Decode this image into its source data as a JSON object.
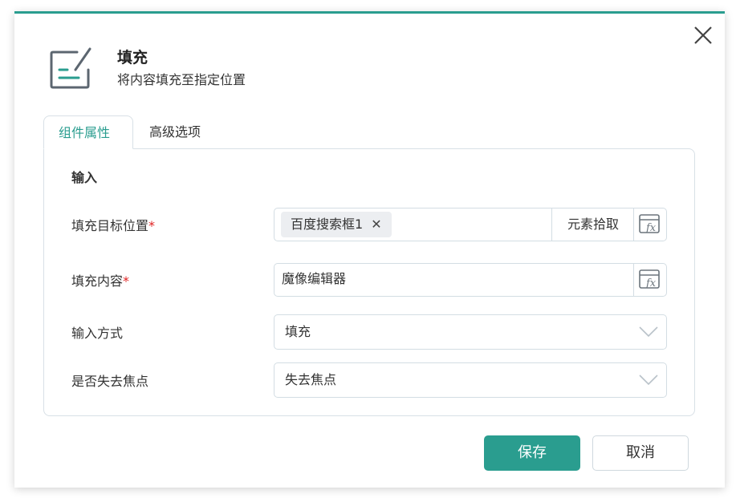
{
  "dialog": {
    "title": "填充",
    "subtitle": "将内容填充至指定位置",
    "icon": "edit-fill-icon",
    "accent_color": "#2a9d8f"
  },
  "tabs": [
    {
      "label": "组件属性",
      "active": true
    },
    {
      "label": "高级选项",
      "active": false
    }
  ],
  "section": {
    "title": "输入"
  },
  "fields": {
    "target": {
      "label": "填充目标位置",
      "required_mark": "*",
      "chip": "百度搜索框1",
      "chip_close": "✕",
      "pick_label": "元素拾取",
      "fx_icon": "fx-icon"
    },
    "content": {
      "label": "填充内容",
      "required_mark": "*",
      "value": "魔像编辑器",
      "fx_icon": "fx-icon"
    },
    "input_mode": {
      "label": "输入方式",
      "value": "填充"
    },
    "blur": {
      "label": "是否失去焦点",
      "value": "失去焦点"
    }
  },
  "buttons": {
    "save": "保存",
    "cancel": "取消"
  }
}
